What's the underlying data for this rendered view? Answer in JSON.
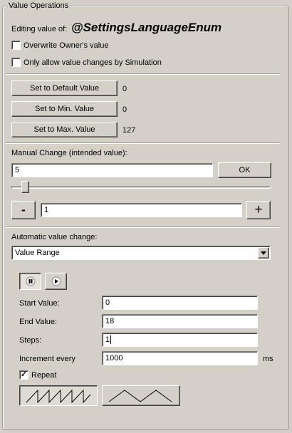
{
  "group_title": "Value Operations",
  "editing": {
    "label": "Editing value of:",
    "name": "@SettingsLanguageEnum"
  },
  "options": {
    "overwrite_owner": {
      "label": "Overwrite Owner's value",
      "checked": false
    },
    "only_simulation": {
      "label": "Only allow value changes by Simulation",
      "checked": false
    }
  },
  "presets": {
    "default": {
      "button": "Set to Default Value",
      "value": "0"
    },
    "min": {
      "button": "Set to Min. Value",
      "value": "0"
    },
    "max": {
      "button": "Set to Max. Value",
      "value": "127"
    }
  },
  "manual": {
    "label": "Manual Change (intended value):",
    "value": "5",
    "ok": "OK",
    "slider_fraction": 0.04,
    "minus": "-",
    "step": "1",
    "plus": "+"
  },
  "automatic": {
    "label": "Automatic value change:",
    "mode": "Value Range",
    "start_label": "Start Value:",
    "start_value": "0",
    "end_label": "End Value:",
    "end_value": "18",
    "steps_label": "Steps:",
    "steps_value": "1",
    "increment_label": "Increment every",
    "increment_value": "1000",
    "increment_unit": "ms",
    "repeat_label": "Repeat",
    "repeat_checked": "✓"
  },
  "icons": {
    "pause": "pause-icon",
    "play": "play-icon",
    "sawtooth": "sawtooth-wave-icon",
    "triangle": "triangle-wave-icon"
  }
}
